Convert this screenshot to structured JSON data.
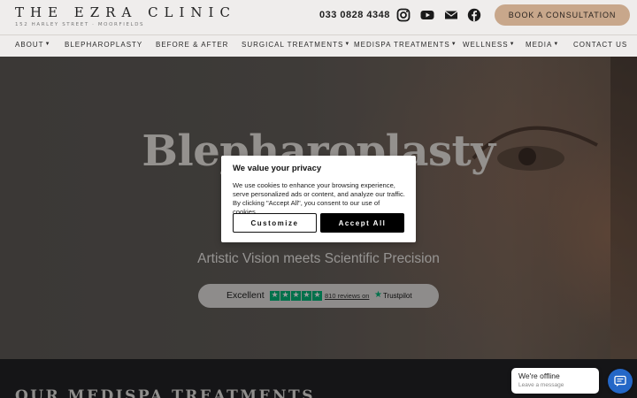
{
  "header": {
    "logo_title": "THE EZRA CLINIC",
    "logo_subtitle": "152 HARLEY STREET · MOORFIELDS",
    "phone": "033 0828 4348",
    "social_icons": [
      "instagram-icon",
      "youtube-icon",
      "email-icon",
      "facebook-icon"
    ],
    "book_button": "BOOK A CONSULTATION",
    "book_button_color": "#c8a78b"
  },
  "nav": {
    "items": [
      {
        "label": "ABOUT",
        "dropdown": true
      },
      {
        "label": "BLEPHAROPLASTY",
        "dropdown": false
      },
      {
        "label": "BEFORE & AFTER",
        "dropdown": false
      },
      {
        "label": "SURGICAL TREATMENTS",
        "dropdown": true
      },
      {
        "label": "MEDISPA TREATMENTS",
        "dropdown": true
      },
      {
        "label": "WELLNESS",
        "dropdown": true
      },
      {
        "label": "MEDIA",
        "dropdown": true
      },
      {
        "label": "CONTACT US",
        "dropdown": false
      }
    ]
  },
  "hero": {
    "title": "Blepharoplasty",
    "tagline": "Artistic Vision meets Scientific Precision",
    "trustpilot": {
      "rating_text": "Excellent",
      "reviews_link": "810 reviews on",
      "brand": "Trustpilot",
      "stars": 5,
      "star_color": "#00b67a"
    }
  },
  "section": {
    "heading": "OUR MEDISPA TREATMENTS"
  },
  "cookie": {
    "title": "We value your privacy",
    "body": "We use cookies to enhance your browsing experience, serve personalized ads or content, and analyze our traffic. By clicking \"Accept All\", you consent to our use of cookies.",
    "customize_label": "Customize",
    "accept_label": "Accept All"
  },
  "chat": {
    "status": "We're offline",
    "leave_message": "Leave a message",
    "button_color": "#2467c7"
  }
}
